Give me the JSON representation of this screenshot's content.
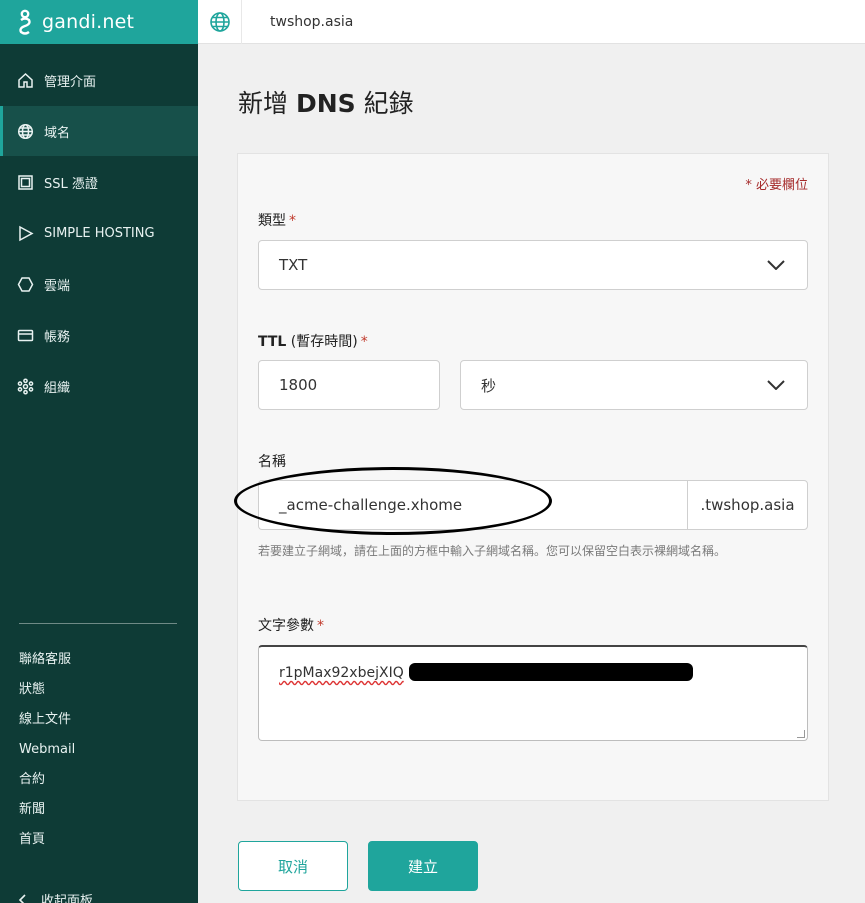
{
  "brand": {
    "name": "gandi.net"
  },
  "sidebar": {
    "items": [
      {
        "label": "管理介面",
        "icon": "home-icon"
      },
      {
        "label": "域名",
        "icon": "globe-icon",
        "active": true
      },
      {
        "label": "SSL 憑證",
        "icon": "certificate-icon"
      },
      {
        "label": "SIMPLE HOSTING",
        "icon": "play-icon"
      },
      {
        "label": "雲端",
        "icon": "hexagon-icon"
      },
      {
        "label": "帳務",
        "icon": "card-icon"
      },
      {
        "label": "組織",
        "icon": "organization-icon"
      }
    ],
    "footer_links": [
      "聯絡客服",
      "狀態",
      "線上文件",
      "Webmail",
      "合約",
      "新聞",
      "首頁"
    ],
    "collapse_label": "收起面板"
  },
  "topbar": {
    "domain": "twshop.asia"
  },
  "page": {
    "title_prefix": "新增 ",
    "title_bold": "DNS",
    "title_suffix": " 紀錄"
  },
  "form": {
    "required_note": "* 必要欄位",
    "type": {
      "label": "類型",
      "value": "TXT"
    },
    "ttl": {
      "label_bold": "TTL",
      "label_rest": " (暫存時間)",
      "value": "1800",
      "unit": "秒"
    },
    "name": {
      "label": "名稱",
      "value": "_acme-challenge.xhome",
      "suffix": ".twshop.asia",
      "hint": "若要建立子網域，請在上面的方框中輸入子網域名稱。您可以保留空白表示裸網域名稱。"
    },
    "text": {
      "label": "文字參數",
      "value": "r1pMax92xbejXIQ"
    },
    "required_star": "*"
  },
  "buttons": {
    "cancel": "取消",
    "create": "建立"
  },
  "colors": {
    "accent": "#1fa59c",
    "sidebar": "#0e3b36",
    "required": "#c0392b"
  }
}
